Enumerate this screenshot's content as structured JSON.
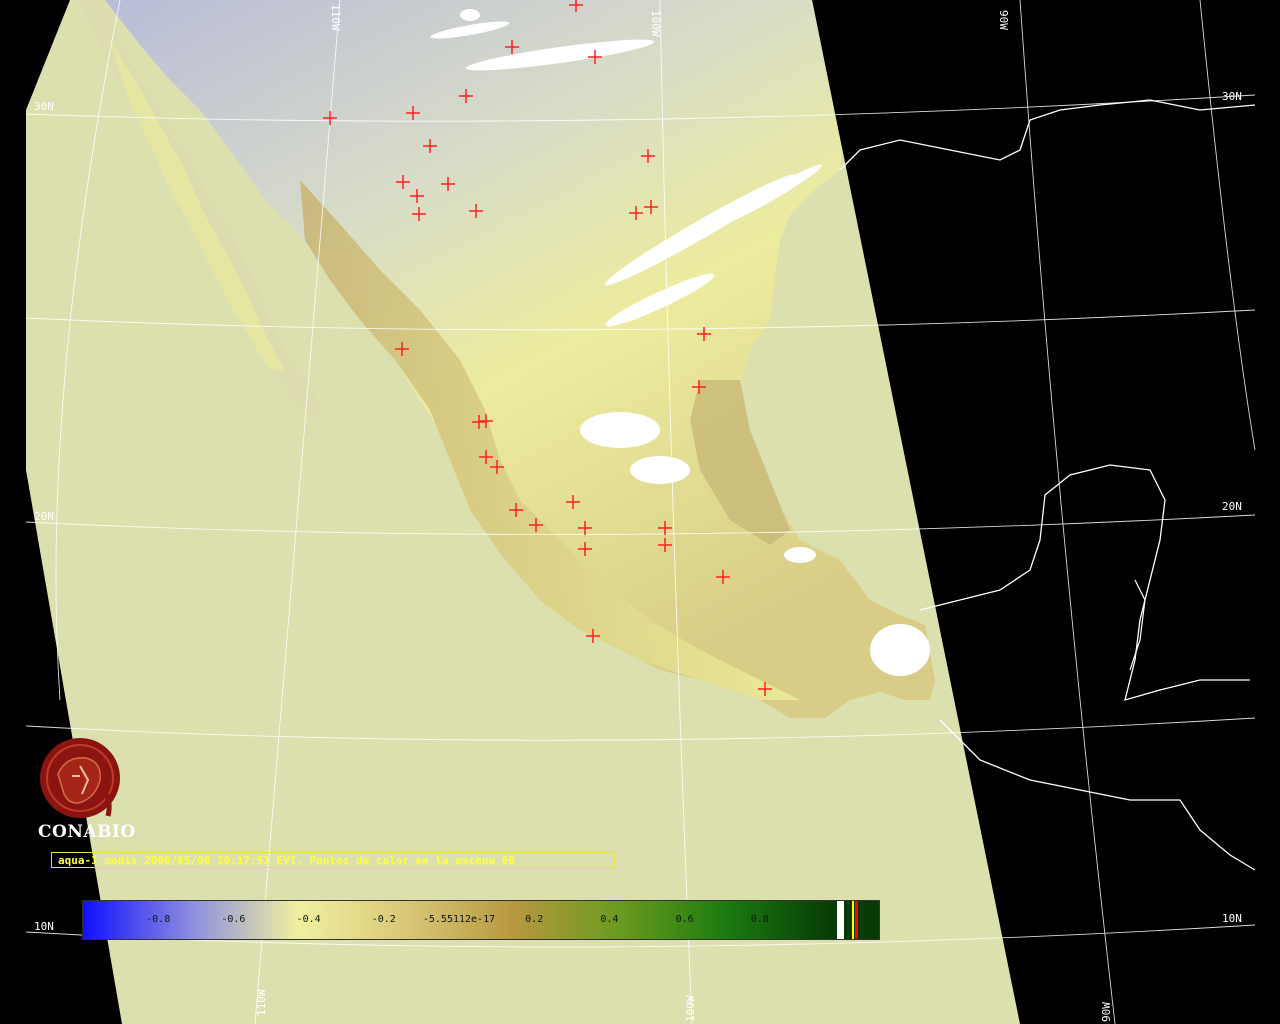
{
  "grid_labels": {
    "lat_30n": "30N",
    "lat_30n_east": "30N",
    "lat_20n": "20N",
    "lat_20n_east": "20N",
    "lat_10n": "10N",
    "lat_10n_east": "10N",
    "lon_110w_top": "110W",
    "lon_100w_top": "100W",
    "lon_90w_top": "90W",
    "lon_110w_bottom": "110W",
    "lon_100w_bottom": "100W",
    "lon_90w_bottom": "90W"
  },
  "logo": {
    "name": "CONABIO"
  },
  "caption": "aqua-1 modis 2008/05/08 20:17:51 EVI. Puntos de calor en la escena 68",
  "colorbar": {
    "tick_labels": [
      "-0.8",
      "-0.6",
      "-0.4",
      "-0.2",
      "-5.55112e-17",
      "0.2",
      "0.4",
      "0.6",
      "0.8"
    ],
    "tick_values": [
      -0.8,
      -0.6,
      -0.4,
      -0.2,
      0.0,
      0.2,
      0.4,
      0.6,
      0.8
    ],
    "range": [
      -1.0,
      1.0
    ],
    "colors": [
      "#1010ff",
      "#8c8ce0",
      "#f0f0a0",
      "#d8c878",
      "#b89840",
      "#6a9a20",
      "#1c7a10",
      "#063a06"
    ],
    "tail_colors": [
      "#ffffff",
      "#063a06",
      "#ffff00",
      "#ff0000"
    ]
  },
  "colors": {
    "background": "#000000",
    "swath": "#dce0ae",
    "land_north": "#b8bcd8",
    "land_yellow": "#eeee9c",
    "land_olive": "#c8b872",
    "cloud": "#ffffff",
    "hotspot": "#ff2020",
    "gridline": "#ffffff"
  }
}
